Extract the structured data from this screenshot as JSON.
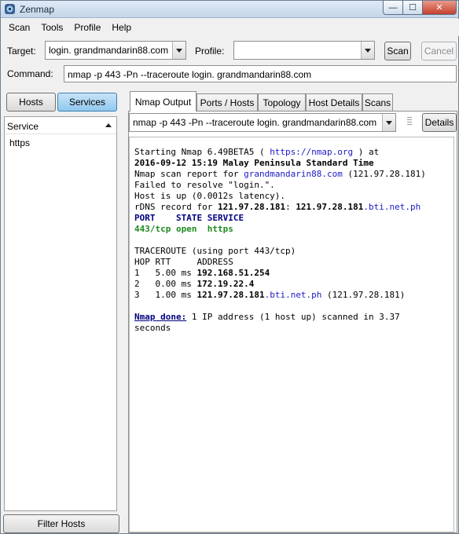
{
  "window": {
    "title": "Zenmap",
    "controls": {
      "minimize": "—",
      "maximize": "☐",
      "close": "✕"
    }
  },
  "menu": [
    "Scan",
    "Tools",
    "Profile",
    "Help"
  ],
  "target": {
    "label": "Target:",
    "value": "login. grandmandarin88.com"
  },
  "profile": {
    "label": "Profile:",
    "value": ""
  },
  "buttons": {
    "scan": "Scan",
    "cancel": "Cancel",
    "details": "Details",
    "filter_hosts": "Filter Hosts"
  },
  "command": {
    "label": "Command:",
    "value": "nmap -p 443 -Pn --traceroute login. grandmandarin88.com"
  },
  "left_panel": {
    "toggles": [
      {
        "label": "Hosts",
        "active": false
      },
      {
        "label": "Services",
        "active": true
      }
    ],
    "list_header": "Service",
    "services": [
      "https"
    ]
  },
  "tabs": [
    {
      "label": "Nmap Output",
      "active": true
    },
    {
      "label": "Ports / Hosts",
      "active": false
    },
    {
      "label": "Topology",
      "active": false
    },
    {
      "label": "Host Details",
      "active": false
    },
    {
      "label": "Scans",
      "active": false
    }
  ],
  "output_selector": {
    "value": "nmap -p 443 -Pn --traceroute login. grandmandarin88.com"
  },
  "output": {
    "line1_prefix": "Starting Nmap 6.49BETA5 ( ",
    "line1_link": "https://nmap.org",
    "line1_suffix": " ) at",
    "line2": "2016-09-12 15:19 Malay Peninsula Standard Time",
    "line3_prefix": "Nmap scan report for ",
    "line3_host": "grandmandarin88.com",
    "line3_ip": " (121.97.28.181)",
    "line4": "Failed to resolve \"login.\".",
    "line5": "Host is up (0.0012s latency).",
    "line6_prefix": "rDNS record for ",
    "line6_ip": "121.97.28.181",
    "line6_sep": ": ",
    "line6_host_ip": "121.97.28.181",
    "line6_domain": ".bti.net.ph",
    "port_header": "PORT    STATE SERVICE",
    "port_row": "443/tcp open  https",
    "trace_title": "TRACEROUTE (using port 443/tcp)",
    "trace_header": "HOP RTT     ADDRESS",
    "hops": [
      {
        "prefix": "1   5.00 ms ",
        "addr": "192.168.51.254",
        "domain": "",
        "suffix": ""
      },
      {
        "prefix": "2   0.00 ms ",
        "addr": "172.19.22.4",
        "domain": "",
        "suffix": ""
      },
      {
        "prefix": "3   1.00 ms ",
        "addr": "121.97.28.181",
        "domain": ".bti.net.ph",
        "suffix": " (121.97.28.181)"
      }
    ],
    "done_label": "Nmap done:",
    "done_text": " 1 IP address (1 host up) scanned in 3.37",
    "done_text2": "seconds"
  }
}
